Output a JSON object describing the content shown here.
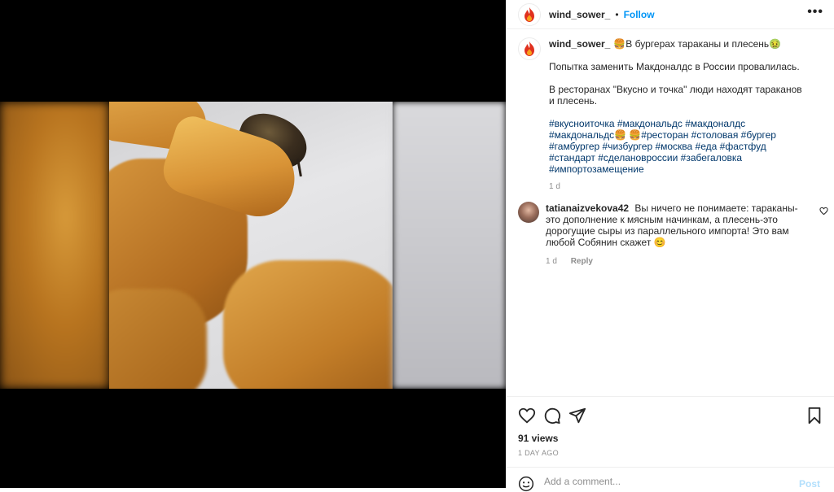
{
  "media": {
    "alt_icon": "fries-with-cockroach-photo"
  },
  "header": {
    "username": "wind_sower_",
    "separator": "•",
    "follow_label": "Follow",
    "more_label": "•••"
  },
  "caption": {
    "username": "wind_sower_",
    "title": "🍔В бургерах тараканы и плесень🤢",
    "line1": "Попытка заменить Макдоналдс в России провалилась.",
    "line2": "В ресторанах \"Вкусно и точка\" люди находят тараканов и плесень.",
    "hashtags": "#вкусноиточка #макдональдс #макдоналдс #макдональдс🍔 🍔#ресторан #столовая #бургер #гамбургер #чизбургер #москва #еда #фастфуд #стандарт #сделановроссии #забегаловка #импортозамещение",
    "age": "1 d"
  },
  "comment": {
    "username": "tatianaizvekova42",
    "text": "Вы ничего не понимаете: тараканы-это дополнение к мясным начинкам, а плесень-это дорогущие сыры из параллельного импорта! Это вам любой Собянин скажет 😊",
    "age": "1 d",
    "reply_label": "Reply"
  },
  "stats": {
    "views": "91 views",
    "date": "1 DAY AGO"
  },
  "add_comment": {
    "placeholder": "Add a comment...",
    "post_label": "Post"
  },
  "colors": {
    "link": "#0095f6",
    "hashtag": "#00376b",
    "muted": "#8e8e8e"
  }
}
